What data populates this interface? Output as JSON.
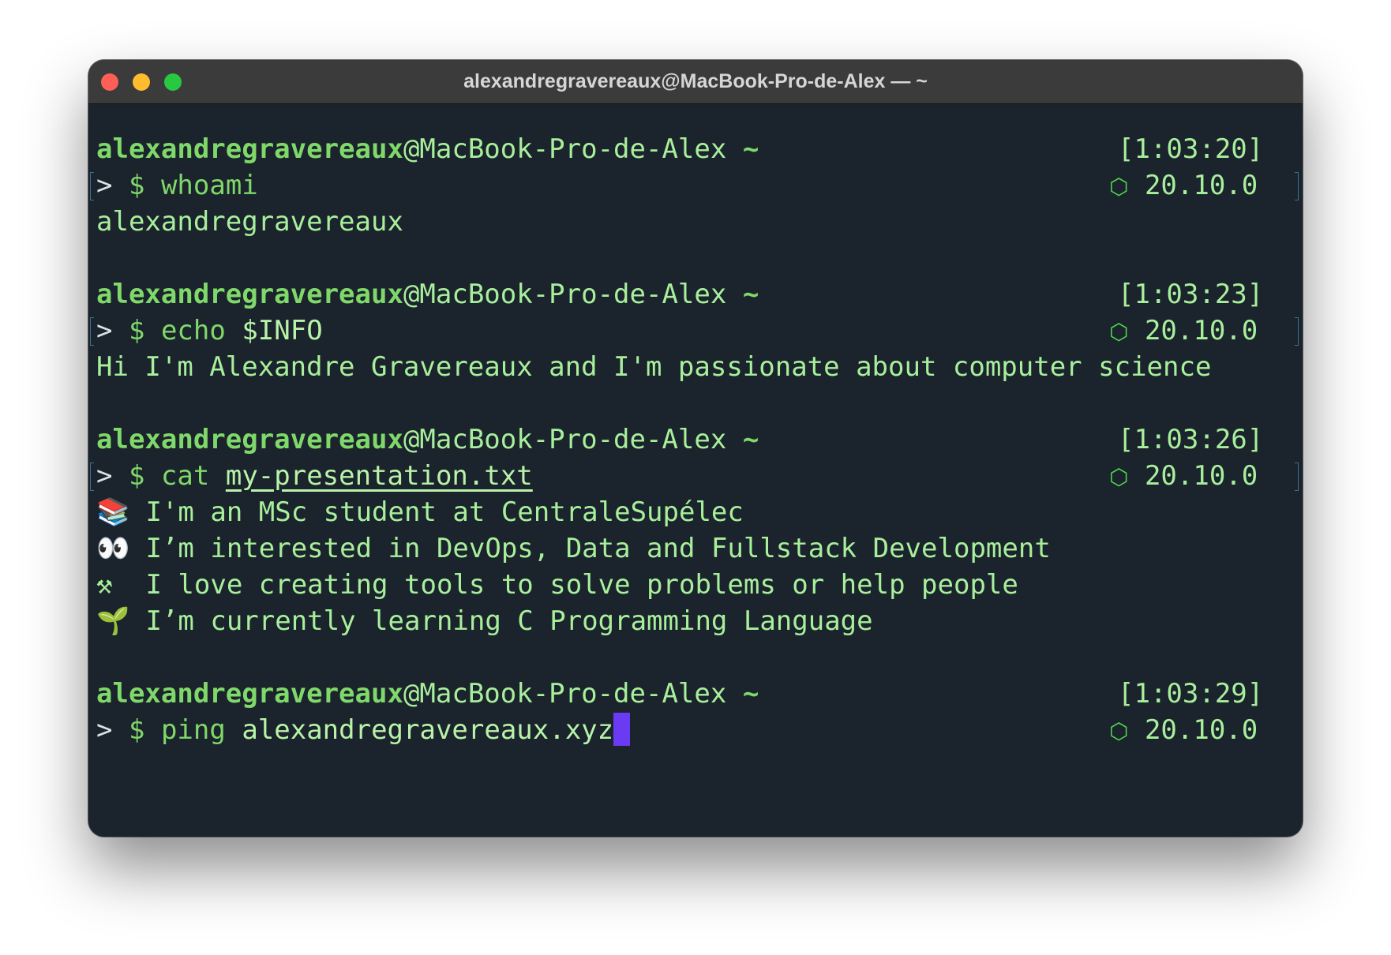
{
  "window": {
    "title": "alexandregravereaux@MacBook-Pro-de-Alex — ~"
  },
  "prompt": {
    "user": "alexandregravereaux",
    "host": "@MacBook-Pro-de-Alex",
    "tilde": " ~",
    "marker": ">",
    "dollar": "$",
    "version": "20.10.0",
    "version_icon": "⬡"
  },
  "blocks": [
    {
      "time": "[1:03:20]",
      "command": "whoami",
      "args": ""
    },
    {
      "time": "[1:03:23]",
      "command": "echo",
      "args": "$INFO"
    },
    {
      "time": "[1:03:26]",
      "command": "cat",
      "args": "my-presentation.txt"
    },
    {
      "time": "[1:03:29]",
      "command": "ping",
      "args": "alexandregravereaux.xyz"
    }
  ],
  "outputs": {
    "whoami": "alexandregravereaux",
    "info": "Hi I'm Alexandre Gravereaux and I'm passionate about computer science",
    "presentation": [
      {
        "emoji": "📚",
        "text": "I'm an MSc student at CentraleSupélec"
      },
      {
        "emoji": "👀",
        "text": "I’m interested in DevOps, Data and Fullstack Development"
      },
      {
        "emoji": "⚒",
        "text": "I love creating tools to solve problems or help people"
      },
      {
        "emoji": "🌱",
        "text": "I’m currently learning C Programming Language"
      }
    ]
  },
  "colors": {
    "background": "#1b232c",
    "text_green": "#a8ef9c",
    "user_green": "#7fd86a",
    "cursor": "#6a3bf2"
  }
}
